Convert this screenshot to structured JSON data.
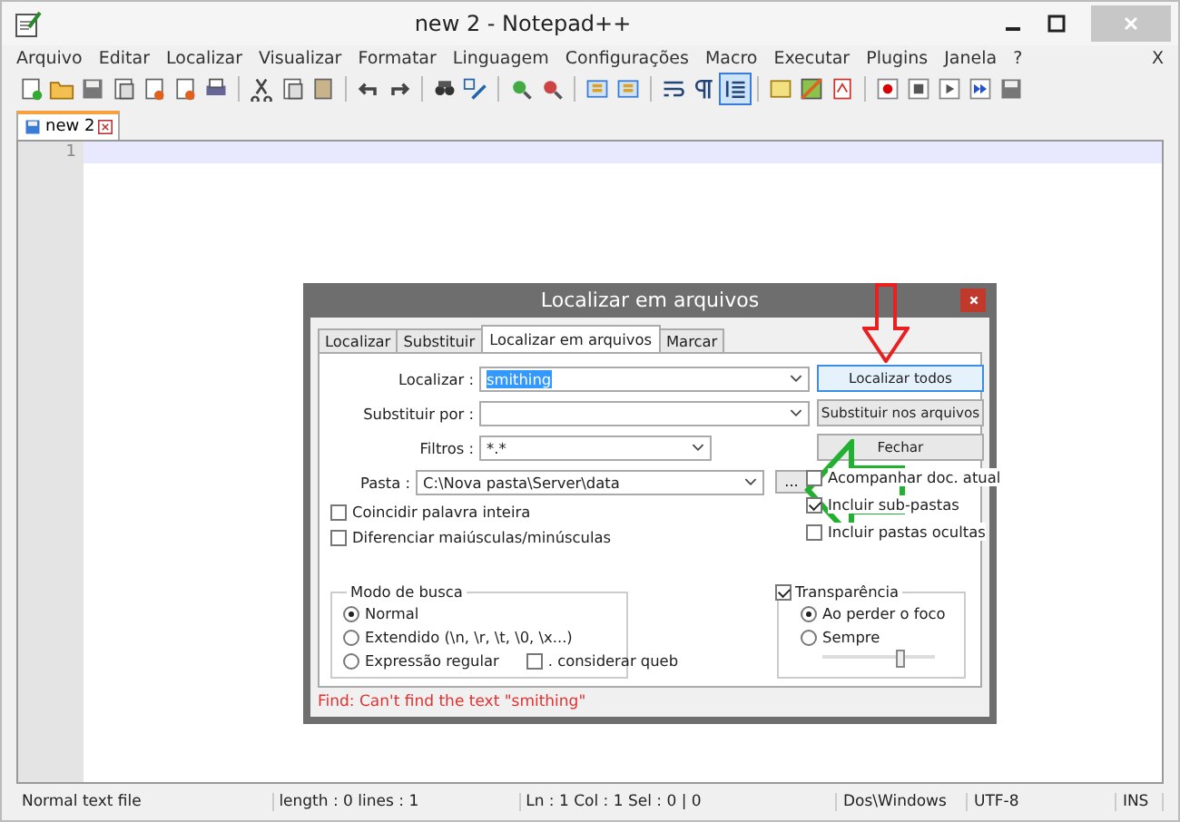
{
  "window": {
    "title": "new 2 - Notepad++"
  },
  "menu": {
    "items": [
      "Arquivo",
      "Editar",
      "Localizar",
      "Visualizar",
      "Formatar",
      "Linguagem",
      "Configurações",
      "Macro",
      "Executar",
      "Plugins",
      "Janela",
      "?"
    ],
    "close": "X"
  },
  "doc_tabs": [
    {
      "label": "new 2",
      "selected": true
    }
  ],
  "editor": {
    "line_numbers": [
      "1"
    ]
  },
  "dialog": {
    "title": "Localizar em arquivos",
    "tabs": [
      {
        "label": "Localizar",
        "selected": false
      },
      {
        "label": "Substituir",
        "selected": false
      },
      {
        "label": "Localizar em arquivos",
        "selected": true
      },
      {
        "label": "Marcar",
        "selected": false
      }
    ],
    "fields": [
      {
        "label": "Localizar :",
        "value": "smithing",
        "text_selected": true
      },
      {
        "label": "Substituir por :"
      },
      {
        "label": "Filtros :",
        "value": "*.*",
        "text_selected": false
      },
      {
        "label": "Pasta :",
        "value": "C:\\Nova pasta\\Server\\data",
        "text_selected": false
      }
    ],
    "browse_button": "...",
    "buttons": [
      "Localizar todos",
      "Substituir nos arquivos",
      "Fechar"
    ],
    "left_options": [
      {
        "label": "Coincidir palavra inteira",
        "checked": false
      },
      {
        "label": "Diferenciar maiúsculas/minúsculas",
        "checked": false
      }
    ],
    "right_options": [
      {
        "label": "Acompanhar doc. atual",
        "checked": false
      },
      {
        "label": "Incluir sub-pastas",
        "checked": true
      },
      {
        "label": "Incluir pastas ocultas",
        "checked": false
      }
    ],
    "search_mode": {
      "title": "Modo de busca",
      "options": [
        {
          "label": "Normal",
          "selected": true
        },
        {
          "label": "Extendido  (\\n, \\r, \\t, \\0, \\x...)",
          "selected": false
        },
        {
          "label": "Expressão regular",
          "selected": false
        }
      ],
      "newline_option": {
        "label": ". considerar queb",
        "checked": false
      }
    },
    "transparency": {
      "label": "Transparência",
      "checked": true,
      "options": [
        {
          "label": "Ao perder o foco",
          "selected": true
        },
        {
          "label": "Sempre",
          "selected": false
        }
      ],
      "level": 0.7
    },
    "message": "Find: Can't find the text \"smithing\""
  },
  "status_bar": [
    "Normal text file",
    "length : 0    lines : 1",
    "Ln : 1    Col : 1    Sel : 0 | 0",
    "Dos\\Windows",
    "UTF-8",
    "INS"
  ]
}
